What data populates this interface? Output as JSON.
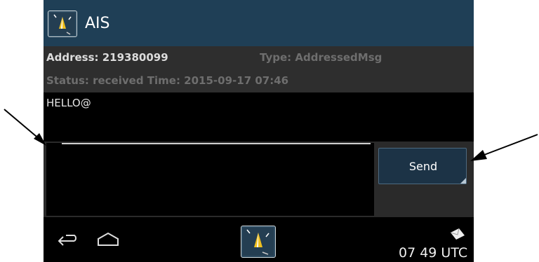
{
  "app": {
    "title": "AIS"
  },
  "message_header": {
    "address": "Address: 219380099",
    "type": "Type: AddressedMsg",
    "status_time": "Status: received Time: 2015-09-17 07:46"
  },
  "message": {
    "body": "HELLO@"
  },
  "compose": {
    "input_value": "",
    "send_label": "Send"
  },
  "navbar": {
    "time": "07 49 UTC",
    "icons": [
      "back-icon",
      "home-icon",
      "ais-app-icon",
      "envelope-icon"
    ]
  },
  "colors": {
    "titlebar": "#1f3f56",
    "info_bg": "#2e2e2e",
    "send_bg": "#1c3346"
  }
}
